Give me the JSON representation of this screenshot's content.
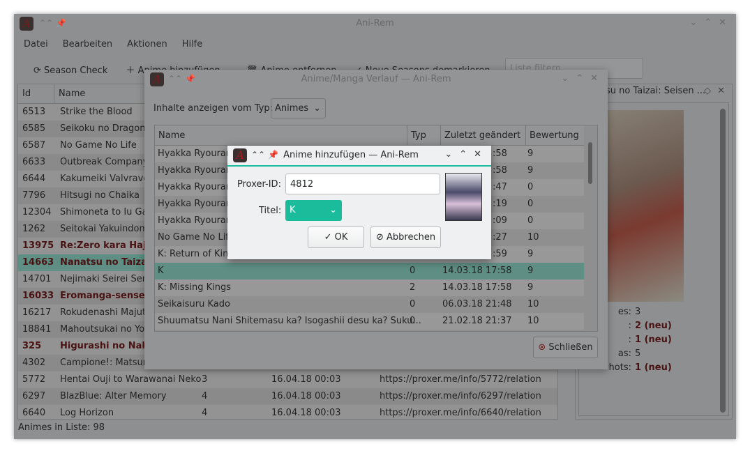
{
  "main": {
    "title": "Ani-Rem",
    "menu": [
      "Datei",
      "Bearbeiten",
      "Aktionen",
      "Hilfe"
    ],
    "toolbar": {
      "season_check": "Season Check",
      "add_anime": "Anime hinzufügen",
      "remove_anime": "Anime entfernen",
      "unmark": "Neue Seasons demarkieren",
      "filter_placeholder": "Liste filtern"
    },
    "table": {
      "headers": [
        "Id",
        "Name"
      ],
      "rows": [
        {
          "id": "6513",
          "name": "Strike the Blood"
        },
        {
          "id": "6585",
          "name": "Seikoku no Dragonar"
        },
        {
          "id": "6587",
          "name": "No Game No Life"
        },
        {
          "id": "6633",
          "name": "Outbreak Company"
        },
        {
          "id": "6644",
          "name": "Kakumeiki Valvrave 2"
        },
        {
          "id": "7796",
          "name": "Hitsugi no Chaika"
        },
        {
          "id": "12304",
          "name": "Shimoneta to Iu Gainen"
        },
        {
          "id": "1262",
          "name": "Seitokai Yakuindomo"
        },
        {
          "id": "13975",
          "name": "Re:Zero kara Hajime",
          "bold": true
        },
        {
          "id": "14663",
          "name": "Nanatsu no Taizai: Seisen",
          "bold": true,
          "selected": true
        },
        {
          "id": "14701",
          "name": "Nejimaki Seirei Senki"
        },
        {
          "id": "16033",
          "name": "Eromanga-sensei",
          "bold": true
        },
        {
          "id": "16217",
          "name": "Rokudenashi Majutsu"
        },
        {
          "id": "18841",
          "name": "Mahoutsukai no Yome"
        },
        {
          "id": "325",
          "name": "Higurashi no Naku",
          "bold": true
        },
        {
          "id": "4302",
          "name": "Campione!: Matsurowanu"
        },
        {
          "id": "5772",
          "name": "Hentai Ouji to Warawanai Neko",
          "typ": "3",
          "date": "16.04.18 00:03",
          "url": "https://proxer.me/info/5772/relation"
        },
        {
          "id": "6297",
          "name": "BlazBlue: Alter Memory",
          "typ": "4",
          "date": "16.04.18 00:03",
          "url": "https://proxer.me/info/6297/relation"
        },
        {
          "id": "6640",
          "name": "Log Horizon",
          "typ": "4",
          "date": "16.04.18 00:03",
          "url": "https://proxer.me/info/6640/relation"
        }
      ]
    },
    "status": "Animes in Liste: 98",
    "detail": {
      "title": "Nanatsu no Taizai: Seisen ...",
      "fields": [
        {
          "label": "es:",
          "value": "3"
        },
        {
          "label": ":",
          "value": "2 (neu)",
          "new": true
        },
        {
          "label": ":",
          "value": "1 (neu)",
          "new": true
        },
        {
          "label": "as:",
          "value": "5"
        },
        {
          "label": "hots:",
          "value": "1 (neu)",
          "new": true
        }
      ]
    }
  },
  "history": {
    "title": "Anime/Manga Verlauf — Ani-Rem",
    "type_label": "Inhalte anzeigen vom Typ:",
    "type_value": "Animes",
    "headers": [
      "Name",
      "Typ",
      "Zuletzt geändert",
      "Bewertung"
    ],
    "rows": [
      {
        "name": "Hyakka Ryouran:",
        "date": ":58",
        "rating": "9"
      },
      {
        "name": "Hyakka Ryouran",
        "date": ":58",
        "rating": "9"
      },
      {
        "name": "Hyakka Ryouran:",
        "date": ":47",
        "rating": "0"
      },
      {
        "name": "Hyakka Ryouran:",
        "date": ":19",
        "rating": "0"
      },
      {
        "name": "Hyakka Ryouran",
        "date": ":09",
        "rating": "0"
      },
      {
        "name": "No Game No Life",
        "date": ":27",
        "rating": "10"
      },
      {
        "name": "K: Return of Kings",
        "date": ":59",
        "rating": "9"
      },
      {
        "name": "K",
        "typ": "0",
        "date": "14.03.18 17:58",
        "rating": "9",
        "selected": true
      },
      {
        "name": "K: Missing Kings",
        "typ": "2",
        "date": "14.03.18 17:58",
        "rating": "9"
      },
      {
        "name": "Seikaisuru Kado",
        "typ": "0",
        "date": "06.03.18 21:48",
        "rating": "10"
      },
      {
        "name": "Shuumatsu Nani Shitemasu ka? Isogashii desu ka? Suku...",
        "typ": "0",
        "date": "21.02.18 21:37",
        "rating": "10"
      }
    ],
    "close": "Schließen"
  },
  "add": {
    "title": "Anime hinzufügen — Ani-Rem",
    "id_label": "Proxer-ID:",
    "id_value": "4812",
    "title_label": "Titel:",
    "title_value": "K",
    "ok": "OK",
    "cancel": "Abbrechen",
    "accent": "#1abc9c"
  }
}
